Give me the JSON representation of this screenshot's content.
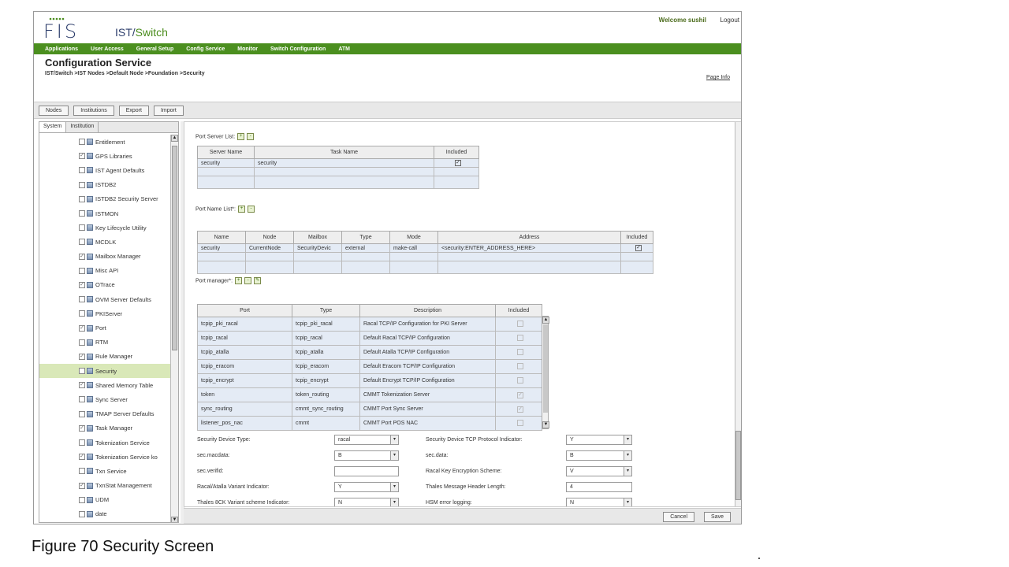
{
  "header": {
    "brand": "FIS",
    "product_prefix": "IST/",
    "product_suffix": "Switch",
    "welcome": "Welcome sushil",
    "logout": "Logout"
  },
  "menu": [
    "Applications",
    "User Access",
    "General Setup",
    "Config Service",
    "Monitor",
    "Switch Configuration",
    "ATM"
  ],
  "page": {
    "title": "Configuration Service",
    "breadcrumb": "IST/Switch >IST Nodes >Default Node >Foundation >Security",
    "page_info": "Page Info"
  },
  "toolbar": [
    "Nodes",
    "Institutions",
    "Export",
    "Import"
  ],
  "left_tabs": [
    "System",
    "Institution"
  ],
  "tree": [
    {
      "label": "Entitlement",
      "checked": false
    },
    {
      "label": "GPS Libraries",
      "checked": true
    },
    {
      "label": "IST Agent Defaults",
      "checked": false
    },
    {
      "label": "ISTDB2",
      "checked": false
    },
    {
      "label": "ISTDB2 Security Server",
      "checked": false
    },
    {
      "label": "ISTMON",
      "checked": false
    },
    {
      "label": "Key Lifecycle Utility",
      "checked": false
    },
    {
      "label": "MCDLK",
      "checked": false
    },
    {
      "label": "Mailbox Manager",
      "checked": true
    },
    {
      "label": "Misc API",
      "checked": false
    },
    {
      "label": "OTrace",
      "checked": true
    },
    {
      "label": "OVM Server Defaults",
      "checked": false
    },
    {
      "label": "PKIServer",
      "checked": false
    },
    {
      "label": "Port",
      "checked": true
    },
    {
      "label": "RTM",
      "checked": false
    },
    {
      "label": "Rule Manager",
      "checked": true
    },
    {
      "label": "Security",
      "checked": false,
      "selected": true
    },
    {
      "label": "Shared Memory Table",
      "checked": true
    },
    {
      "label": "Sync Server",
      "checked": false
    },
    {
      "label": "TMAP Server Defaults",
      "checked": false
    },
    {
      "label": "Task Manager",
      "checked": true
    },
    {
      "label": "Tokenization Service",
      "checked": false
    },
    {
      "label": "Tokenization Service ko",
      "checked": true
    },
    {
      "label": "Txn Service",
      "checked": false
    },
    {
      "label": "TxnStat Management",
      "checked": true
    },
    {
      "label": "UDM",
      "checked": false
    },
    {
      "label": "date",
      "checked": false
    }
  ],
  "port_server": {
    "label": "Port Server List:",
    "headers": [
      "Server Name",
      "Task Name",
      "Included"
    ],
    "rows": [
      {
        "server": "security",
        "task": "security",
        "included": true
      }
    ]
  },
  "port_name": {
    "label": "Port Name List*:",
    "headers": [
      "Name",
      "Node",
      "Mailbox",
      "Type",
      "Mode",
      "Address",
      "Included"
    ],
    "rows": [
      {
        "name": "security",
        "node": "CurrentNode",
        "mailbox": "SecurityDevic",
        "type": "external",
        "mode": "make-call",
        "address": "<security:ENTER_ADDRESS_HERE>",
        "included": true
      }
    ]
  },
  "port_manager": {
    "label": "Port manager*:",
    "headers": [
      "Port",
      "Type",
      "Description",
      "Included"
    ],
    "rows": [
      {
        "port": "tcpip_pki_racal",
        "type": "tcpip_pki_racal",
        "desc": "Racal TCP/IP Configuration for PKI Server",
        "included": false
      },
      {
        "port": "tcpip_racal",
        "type": "tcpip_racal",
        "desc": "Default Racal TCP/IP Configuration",
        "included": false
      },
      {
        "port": "tcpip_atalla",
        "type": "tcpip_atalla",
        "desc": "Default Atalla TCP/IP Configuration",
        "included": false
      },
      {
        "port": "tcpip_eracom",
        "type": "tcpip_eracom",
        "desc": "Default Eracom TCP/IP Configuration",
        "included": false
      },
      {
        "port": "tcpip_encrypt",
        "type": "tcpip_encrypt",
        "desc": "Default Encrypt TCP/IP Configuration",
        "included": false
      },
      {
        "port": "token",
        "type": "token_routing",
        "desc": "CMMT Tokenization Server",
        "included": true
      },
      {
        "port": "sync_routing",
        "type": "cmmt_sync_routing",
        "desc": "CMMT Port Sync Server",
        "included": true
      },
      {
        "port": "listener_pos_nac",
        "type": "cmmt",
        "desc": "CMMT Port POS NAC",
        "included": false
      }
    ]
  },
  "form": {
    "left": [
      {
        "label": "Security Device Type:",
        "value": "racal",
        "dropdown": true
      },
      {
        "label": "sec.macdata:",
        "value": "B",
        "dropdown": true
      },
      {
        "label": "sec.verifid:",
        "value": "",
        "dropdown": false
      },
      {
        "label": "Racal/Atalla Variant Indicator:",
        "value": "Y",
        "dropdown": true
      },
      {
        "label": "Thales 8CK Variant scheme Indicator:",
        "value": "N",
        "dropdown": true
      }
    ],
    "right": [
      {
        "label": "Security Device TCP Protocol Indicator:",
        "value": "Y",
        "dropdown": true
      },
      {
        "label": "sec.data:",
        "value": "B",
        "dropdown": true
      },
      {
        "label": "Racal Key Encryption Scheme:",
        "value": "V",
        "dropdown": true
      },
      {
        "label": "Thales Message Header Length:",
        "value": "4",
        "dropdown": false
      },
      {
        "label": "HSM error logging:",
        "value": "N",
        "dropdown": true
      }
    ]
  },
  "buttons": {
    "cancel": "Cancel",
    "save": "Save"
  },
  "caption": "Figure 70 Security Screen",
  "colors": {
    "menubar": "#4b8f1f",
    "selected": "#d9e8b8"
  }
}
